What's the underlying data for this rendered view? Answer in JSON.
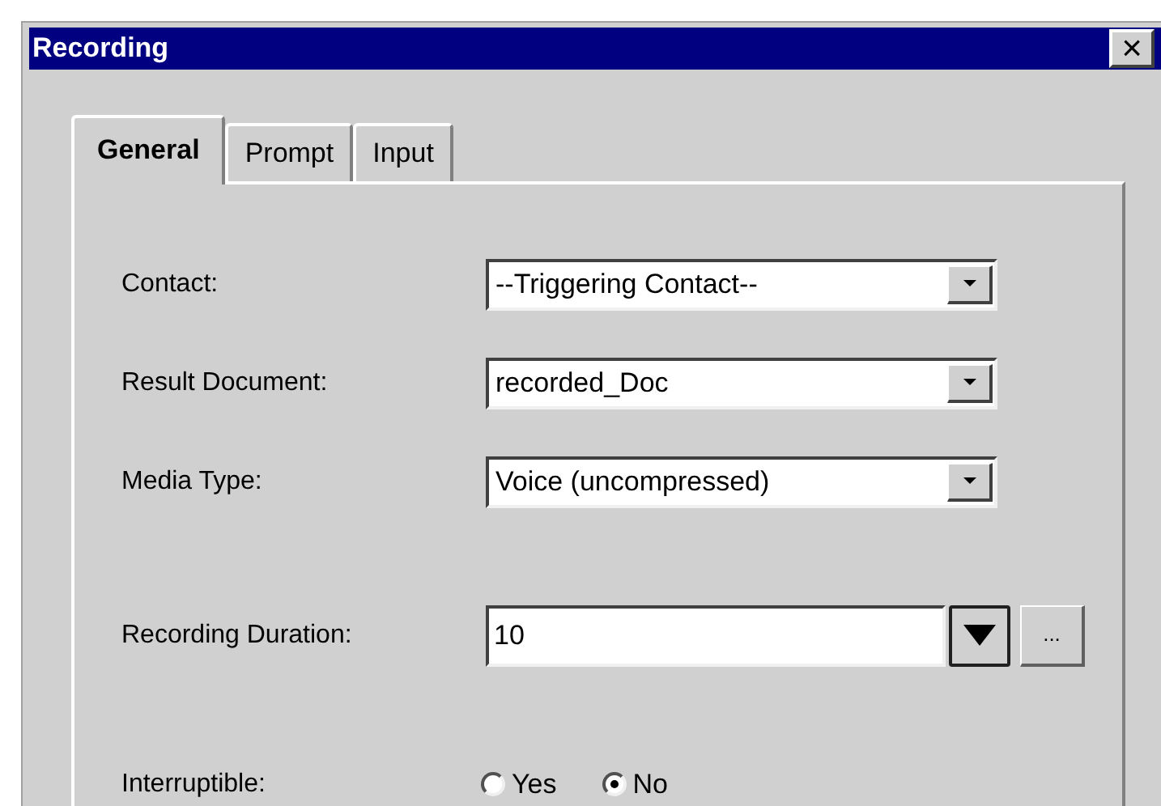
{
  "window": {
    "title": "Recording",
    "close": "×"
  },
  "tabs": [
    {
      "label": "General",
      "selected": true
    },
    {
      "label": "Prompt",
      "selected": false
    },
    {
      "label": "Input",
      "selected": false
    }
  ],
  "fields": [
    {
      "kind": "dropdown",
      "label": "Contact:",
      "value": "--Triggering Contact--"
    },
    {
      "kind": "dropdown",
      "label": "Result Document:",
      "value": "recorded_Doc"
    },
    {
      "kind": "dropdown",
      "label": "Media Type:",
      "value": "Voice (uncompressed)"
    },
    {
      "kind": "spin",
      "label": "Recording Duration:",
      "value": "10",
      "browse": "..."
    },
    {
      "kind": "radio",
      "label": "Interruptible:",
      "options": [
        {
          "label": "Yes",
          "selected": false
        },
        {
          "label": "No",
          "selected": true
        }
      ]
    }
  ]
}
